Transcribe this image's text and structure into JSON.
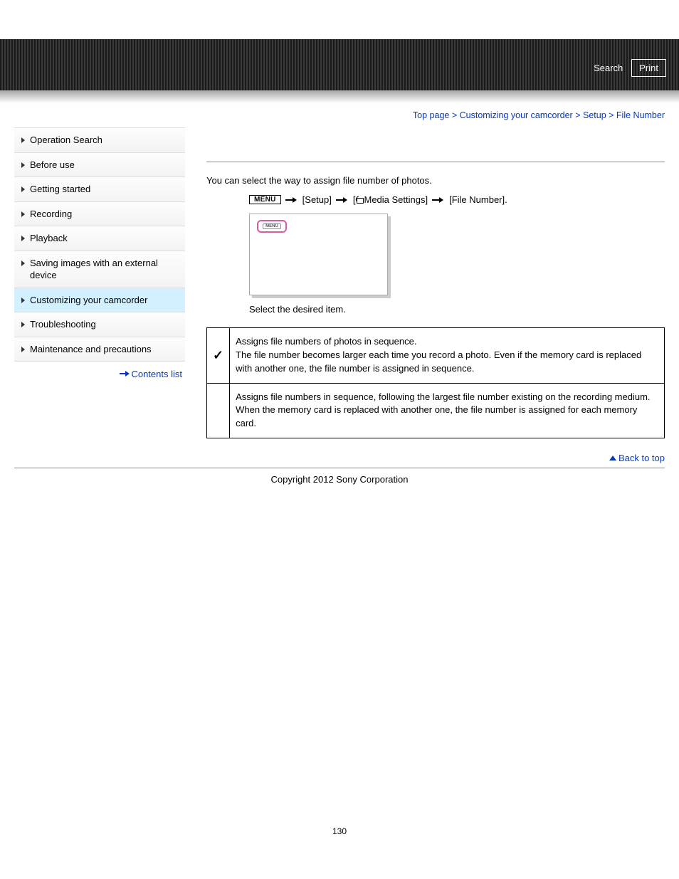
{
  "header": {
    "search": "Search",
    "print": "Print"
  },
  "breadcrumb": {
    "top": "Top page",
    "cat": "Customizing your camcorder",
    "sub": "Setup",
    "current": "File Number"
  },
  "sidebar": {
    "items": [
      "Operation Search",
      "Before use",
      "Getting started",
      "Recording",
      "Playback",
      "Saving images with an external device",
      "Customizing your camcorder",
      "Troubleshooting",
      "Maintenance and precautions"
    ],
    "contents": "Contents list"
  },
  "content": {
    "intro": "You can select the way to assign file number of photos.",
    "menu_label": "MENU",
    "path_setup": "[Setup]",
    "path_media": "Media Settings]",
    "path_media_prefix": "[",
    "path_file": "[File Number].",
    "menu_chip": "MENU",
    "step2": "Select the desired item.",
    "options": [
      {
        "checked": true,
        "text": "Assigns file numbers of photos in sequence.\nThe file number becomes larger each time you record a photo. Even if the memory card is replaced with another one, the file number is assigned in sequence."
      },
      {
        "checked": false,
        "text": "Assigns file numbers in sequence, following the largest file number existing on the recording medium.\nWhen the memory card is replaced with another one, the file number is assigned for each memory card."
      }
    ]
  },
  "backtop": "Back to top",
  "copyright": "Copyright 2012 Sony Corporation",
  "pagenum": "130"
}
